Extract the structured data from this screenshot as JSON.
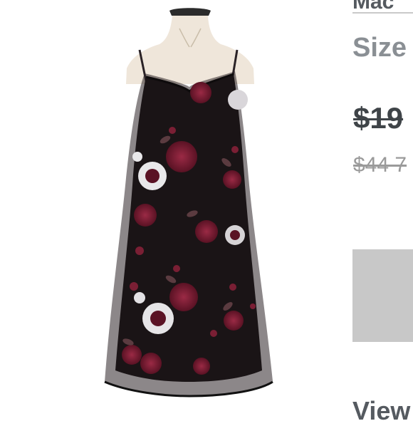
{
  "listing": {
    "brand_partial": "Mac",
    "size_label": "Size",
    "price": "$19",
    "retail_price": "$44 7",
    "view_partial": "View"
  },
  "image": {
    "subject": "black floral slip dress on dress form",
    "colors": {
      "dress": "#1a1416",
      "flower_red": "#7a1f34",
      "flower_white": "#e9e8ea",
      "form": "#efe6da",
      "stand": "#2b2b2b"
    }
  },
  "theme": {
    "text_dark": "#3f4448",
    "text_muted": "#8a8f94",
    "button_gray": "#c8c8c8"
  }
}
